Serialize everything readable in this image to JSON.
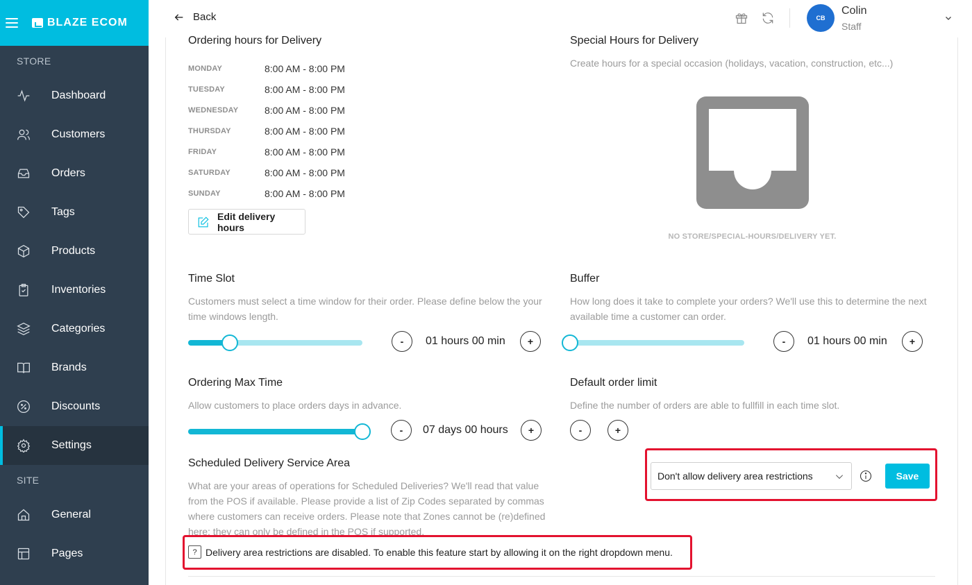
{
  "app": {
    "brand": "BLAZE ECOM"
  },
  "sidebar": {
    "store_label": "STORE",
    "site_label": "SITE",
    "items": [
      {
        "label": "Dashboard",
        "icon": "activity-icon"
      },
      {
        "label": "Customers",
        "icon": "users-icon"
      },
      {
        "label": "Orders",
        "icon": "inbox-icon"
      },
      {
        "label": "Tags",
        "icon": "tag-icon"
      },
      {
        "label": "Products",
        "icon": "box-icon"
      },
      {
        "label": "Inventories",
        "icon": "clipboard-icon"
      },
      {
        "label": "Categories",
        "icon": "layers-icon"
      },
      {
        "label": "Brands",
        "icon": "book-icon"
      },
      {
        "label": "Discounts",
        "icon": "percent-icon"
      },
      {
        "label": "Settings",
        "icon": "gear-icon",
        "active": true
      }
    ],
    "site_items": [
      {
        "label": "General",
        "icon": "home-icon"
      },
      {
        "label": "Pages",
        "icon": "layout-icon"
      }
    ]
  },
  "header": {
    "back_label": "Back",
    "user": {
      "initials": "CB",
      "name": "Colin",
      "role": "Staff"
    }
  },
  "delivery_hours": {
    "title": "Ordering hours for Delivery",
    "days": [
      {
        "day": "MONDAY",
        "hours": "8:00 AM - 8:00 PM"
      },
      {
        "day": "TUESDAY",
        "hours": "8:00 AM - 8:00 PM"
      },
      {
        "day": "WEDNESDAY",
        "hours": "8:00 AM - 8:00 PM"
      },
      {
        "day": "THURSDAY",
        "hours": "8:00 AM - 8:00 PM"
      },
      {
        "day": "FRIDAY",
        "hours": "8:00 AM - 8:00 PM"
      },
      {
        "day": "SATURDAY",
        "hours": "8:00 AM - 8:00 PM"
      },
      {
        "day": "SUNDAY",
        "hours": "8:00 AM - 8:00 PM"
      }
    ],
    "edit_label": "Edit delivery hours"
  },
  "special_hours": {
    "title": "Special Hours for Delivery",
    "description": "Create hours for a special occasion (holidays, vacation, construction, etc...)",
    "empty_text": "NO STORE/SPECIAL-HOURS/DELIVERY YET."
  },
  "time_slot": {
    "title": "Time Slot",
    "description_1": "Customers must select a time window for their order. Please define below the your",
    "description_2": "time windows length.",
    "value": "01 hours 00 min",
    "slider_fraction": 0.24,
    "minus": "-",
    "plus": "+"
  },
  "buffer": {
    "title": "Buffer",
    "description_1": "How long does it take to complete your orders? We'll use this to determine the next",
    "description_2": "available time a customer can order.",
    "value": "01 hours 00 min",
    "slider_fraction": 0.0,
    "minus": "-",
    "plus": "+"
  },
  "max_time": {
    "title": "Ordering Max Time",
    "description": "Allow customers to place orders days in advance.",
    "value": "07 days 00 hours",
    "slider_fraction": 1.0,
    "minus": "-",
    "plus": "+"
  },
  "order_limit": {
    "title": "Default order limit",
    "description": "Define the number of orders are able to fullfill in each time slot.",
    "minus": "-",
    "plus": "+"
  },
  "service_area": {
    "title": "Scheduled Delivery Service Area",
    "description_1": "What are your areas of operations for Scheduled Deliveries? We'll read that value",
    "description_2": "from the POS if available. Please provide a list of Zip Codes separated by commas",
    "description_3": "where customers can receive orders. Please note that Zones cannot be (re)defined",
    "description_4": "here; they can only be defined in the POS if supported.",
    "select_value": "Don't allow delivery area restrictions",
    "save_label": "Save",
    "notice_icon": "?",
    "notice": "Delivery area restrictions are disabled. To enable this feature start by allowing it on the right dropdown menu."
  },
  "colors": {
    "accent": "#00bde0",
    "sidebar": "#2f3f4f",
    "highlight": "#e3122f"
  }
}
